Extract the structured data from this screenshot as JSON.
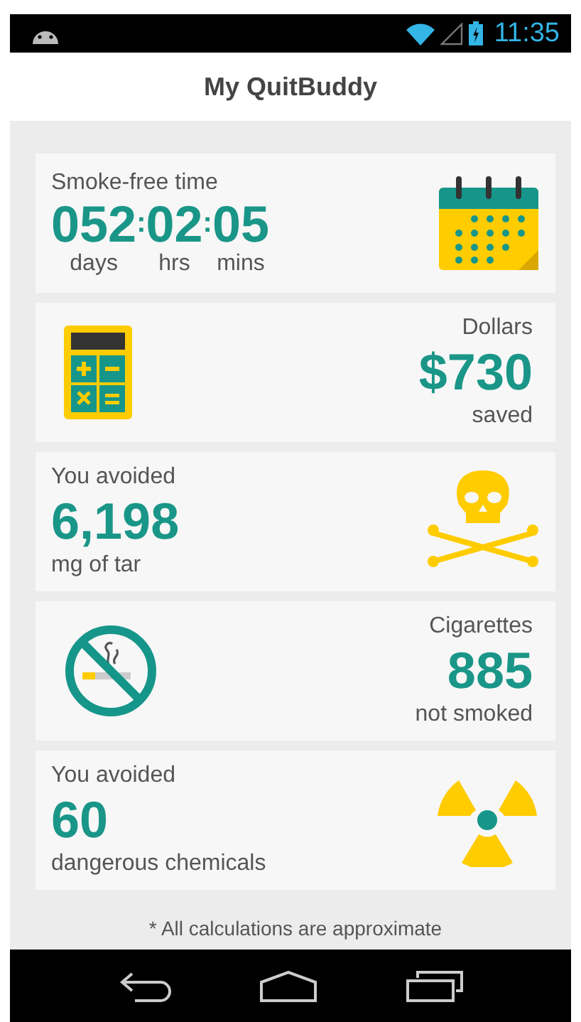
{
  "status_bar": {
    "time": "11:35"
  },
  "app_bar": {
    "title": "My QuitBuddy"
  },
  "cards": [
    {
      "kind": "timer",
      "label": "Smoke-free time",
      "separators": [
        ":",
        ":"
      ],
      "parts": [
        {
          "value": "052",
          "unit": "days"
        },
        {
          "value": "02",
          "unit": "hrs"
        },
        {
          "value": "05",
          "unit": "mins"
        }
      ]
    },
    {
      "kind": "right",
      "label": "Dollars",
      "value": "$730",
      "caption": "saved"
    },
    {
      "kind": "left",
      "label": "You avoided",
      "value": "6,198",
      "caption": "mg of tar"
    },
    {
      "kind": "right",
      "label": "Cigarettes",
      "value": "885",
      "caption": "not smoked"
    },
    {
      "kind": "left",
      "label": "You avoided",
      "value": "60",
      "caption": "dangerous chemicals"
    }
  ],
  "footnote": "* All calculations are approximate"
}
